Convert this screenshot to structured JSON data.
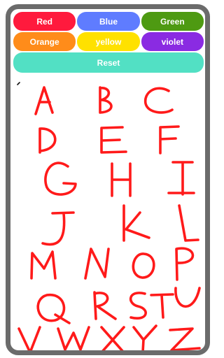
{
  "colors": {
    "frame": "#6b6b6b",
    "ink": "#ff1a1a",
    "dot": "#111111"
  },
  "buttons": {
    "row1": [
      {
        "name": "red-button",
        "label": "Red",
        "color": "#ff1a3d"
      },
      {
        "name": "blue-button",
        "label": "Blue",
        "color": "#5f7cff"
      },
      {
        "name": "green-button",
        "label": "Green",
        "color": "#4e9a12"
      }
    ],
    "row2": [
      {
        "name": "orange-button",
        "label": "Orange",
        "color": "#ff8c1a"
      },
      {
        "name": "yellow-button",
        "label": "yellow",
        "color": "#ffe100"
      },
      {
        "name": "violet-button",
        "label": "violet",
        "color": "#8a2be2"
      }
    ],
    "reset": {
      "label": "Reset",
      "color": "#52e0c4"
    }
  }
}
